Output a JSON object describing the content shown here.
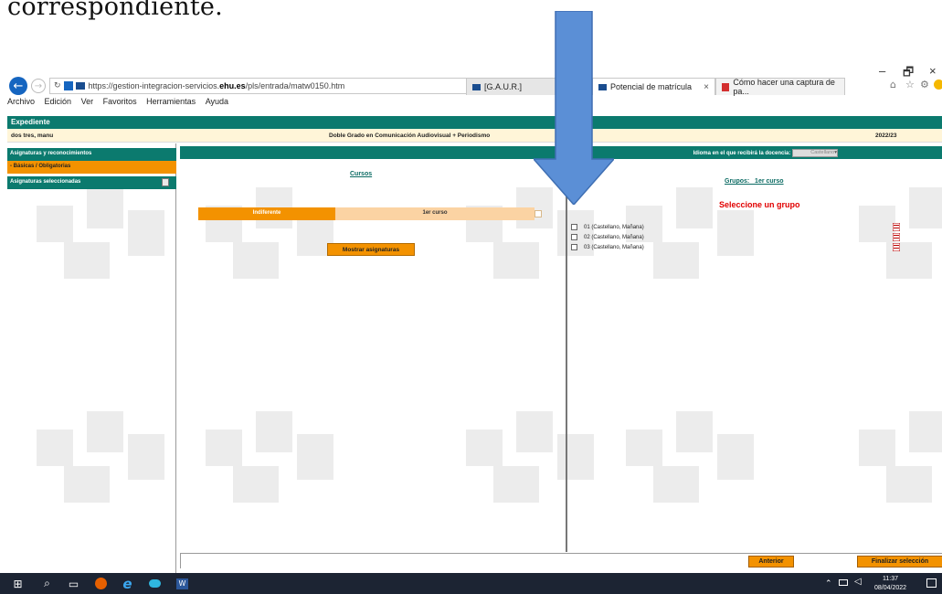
{
  "caption": "correspondiente.",
  "browser": {
    "url_prefix": "https://gestion-integracion-servicios.",
    "url_domain": "ehu.es",
    "url_path": "/pls/entrada/matw0150.htm",
    "search_symbols": "⌕ ▾ 🔒",
    "tabs": [
      {
        "label": "[G.A.U.R.]"
      },
      {
        "label": "Potencial de matrícula"
      },
      {
        "label": "Cómo hacer una captura de pa..."
      }
    ],
    "tab_close": "×",
    "window_controls": [
      "–",
      "🗗",
      "×"
    ],
    "menu": [
      "Archivo",
      "Edición",
      "Ver",
      "Favoritos",
      "Herramientas",
      "Ayuda"
    ]
  },
  "page": {
    "header_title": "Expediente",
    "student_name": "dos tres, manu",
    "degree": "Doble Grado en Comunicación Audiovisual + Periodismo",
    "year": "2022/23",
    "sidebar": {
      "section": "Asignaturas y reconocimientos",
      "item_active": "- Básicas / Obligatorias",
      "selected": "Asignaturas seleccionadas"
    },
    "idioma_label": "Idioma en el que recibirá la docencia:",
    "idioma_value": "Castellano",
    "cursos_link": "Cursos",
    "cursos_options": [
      "Indiferente",
      "1er curso"
    ],
    "mostrar_button": "Mostrar asignaturas",
    "grupos_link": "Grupos:   1er curso",
    "select_message": "Seleccione un grupo",
    "groups": [
      {
        "label": "01 (Castellano, Mañana)"
      },
      {
        "label": "02 (Castellano, Mañana)"
      },
      {
        "label": "03 (Castellano, Mañana)"
      }
    ],
    "btn_prev": "Anterior",
    "btn_finish": "Finalizar selección"
  },
  "taskbar": {
    "time": "11:37",
    "date": "08/04/2022"
  },
  "colors": {
    "teal": "#0b7a6e",
    "orange": "#f39200",
    "arrow_blue": "#5b8fd6",
    "red": "#e10000"
  }
}
